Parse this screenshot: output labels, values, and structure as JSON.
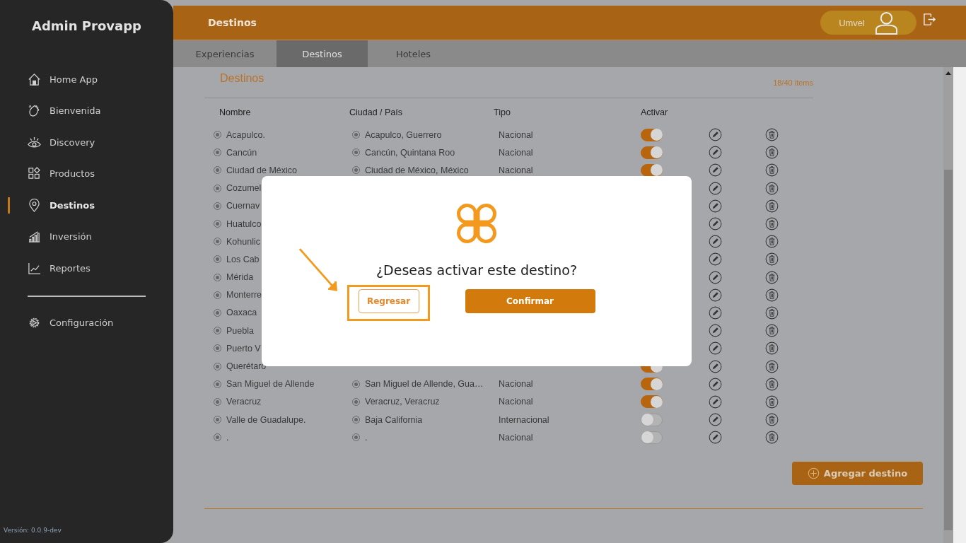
{
  "sidebar": {
    "title": "Admin Provapp",
    "items": [
      {
        "label": "Home App",
        "selected": false
      },
      {
        "label": "Bienvenida",
        "selected": false
      },
      {
        "label": "Discovery",
        "selected": false
      },
      {
        "label": "Productos",
        "selected": false
      },
      {
        "label": "Destinos",
        "selected": true
      },
      {
        "label": "Inversión",
        "selected": false
      },
      {
        "label": "Reportes",
        "selected": false
      }
    ],
    "settings": "Configuración",
    "version": "Versión: 0.0.9-dev"
  },
  "header": {
    "title": "Destinos",
    "user": "Umvel"
  },
  "tabs": [
    {
      "label": "Experiencias",
      "selected": false
    },
    {
      "label": "Destinos",
      "selected": true
    },
    {
      "label": "Hoteles",
      "selected": false
    }
  ],
  "section": {
    "title": "Destinos",
    "count": "18/40 items"
  },
  "table": {
    "columns": [
      "Nombre",
      "Ciudad / País",
      "Tipo",
      "Activar"
    ],
    "rows": [
      {
        "name": "Acapulco.",
        "city": "Acapulco, Guerrero",
        "type": "Nacional",
        "on": true
      },
      {
        "name": "Cancún",
        "city": "Cancún, Quintana Roo",
        "type": "Nacional",
        "on": true
      },
      {
        "name": "Ciudad de México",
        "city": "Ciudad de México, México",
        "type": "Nacional",
        "on": true
      },
      {
        "name": "Cozumel"
      },
      {
        "name": "Cuernav"
      },
      {
        "name": "Huatulco"
      },
      {
        "name": "Kohunlic"
      },
      {
        "name": "Los Cab"
      },
      {
        "name": "Mérida"
      },
      {
        "name": "Monterre"
      },
      {
        "name": "Oaxaca"
      },
      {
        "name": "Puebla"
      },
      {
        "name": "Puerto V"
      },
      {
        "name": "Querétaro",
        "on": true
      },
      {
        "name": "San Miguel de Allende",
        "city": "San Miguel de Allende, Gua…",
        "type": "Nacional",
        "on": true
      },
      {
        "name": "Veracruz",
        "city": "Veracruz, Veracruz",
        "type": "Nacional",
        "on": true
      },
      {
        "name": "Valle de Guadalupe.",
        "city": "Baja California",
        "type": "Internacional",
        "on": false
      },
      {
        "name": ".",
        "city": ".",
        "type": "Nacional",
        "on": false
      }
    ]
  },
  "add_button": "Agregar destino",
  "dialog": {
    "title": "¿Deseas activar este destino?",
    "buttons": [
      {
        "label": "Regresar",
        "kind": "secondary"
      },
      {
        "label": "Confirmar",
        "kind": "primary"
      }
    ]
  }
}
